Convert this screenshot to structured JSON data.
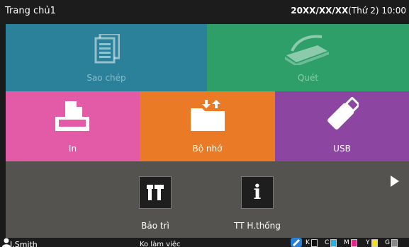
{
  "header": {
    "title": "Trang chủ1",
    "datetime": "20XX/XX/XX",
    "day": "(Thứ 2)",
    "time": "10:00"
  },
  "tiles": {
    "copy": "Sao chép",
    "scan": "Quét",
    "print": "In",
    "memory": "Bộ nhớ",
    "usb": "USB"
  },
  "tools": {
    "maintenance": "Bảo trì",
    "system_info": "TT H.thống"
  },
  "status": {
    "user": "J.Smith",
    "work_status": "Ko làm việc",
    "ink": [
      {
        "label": "K",
        "color": "#111111"
      },
      {
        "label": "C",
        "color": "#1fb6e6"
      },
      {
        "label": "M",
        "color": "#e5258c"
      },
      {
        "label": "Y",
        "color": "#f4e11a"
      },
      {
        "label": "G",
        "color": "#888888"
      }
    ]
  },
  "colors": {
    "copy": "#2a8199",
    "scan": "#2e9f68",
    "print": "#e35aa6",
    "memory": "#eb7a26",
    "usb": "#8c46a1",
    "lower": "#555350"
  }
}
